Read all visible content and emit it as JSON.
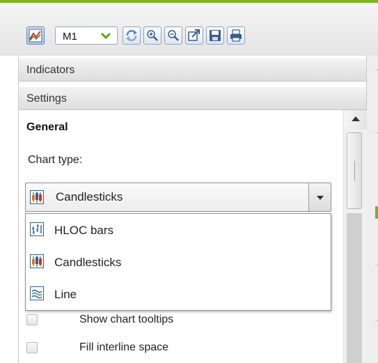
{
  "toolbar": {
    "timeframe": "M1",
    "buttons": [
      {
        "name": "chart-type-button",
        "icon": "area-chart-icon"
      },
      {
        "name": "refresh-button",
        "icon": "refresh-icon"
      },
      {
        "name": "zoom-in-button",
        "icon": "zoom-in-icon"
      },
      {
        "name": "zoom-out-button",
        "icon": "zoom-out-icon"
      },
      {
        "name": "open-external-button",
        "icon": "external-link-icon"
      },
      {
        "name": "save-button",
        "icon": "floppy-disk-icon"
      },
      {
        "name": "print-button",
        "icon": "printer-icon"
      }
    ]
  },
  "sections": {
    "indicators": "Indicators",
    "settings": "Settings"
  },
  "settings": {
    "group_title": "General",
    "chart_type_label": "Chart type:",
    "chart_type_selected": "Candlesticks",
    "chart_type_options": [
      {
        "label": "HLOC bars",
        "icon": "hloc-bars-icon"
      },
      {
        "label": "Candlesticks",
        "icon": "candlesticks-icon"
      },
      {
        "label": "Line",
        "icon": "line-chart-icon"
      }
    ],
    "checkboxes": [
      {
        "label": "Show chart tooltips",
        "checked": false
      },
      {
        "label": "Fill interline space",
        "checked": false
      }
    ]
  },
  "colors": {
    "accent_green": "#7db21e",
    "button_border": "#8fa3bd"
  }
}
